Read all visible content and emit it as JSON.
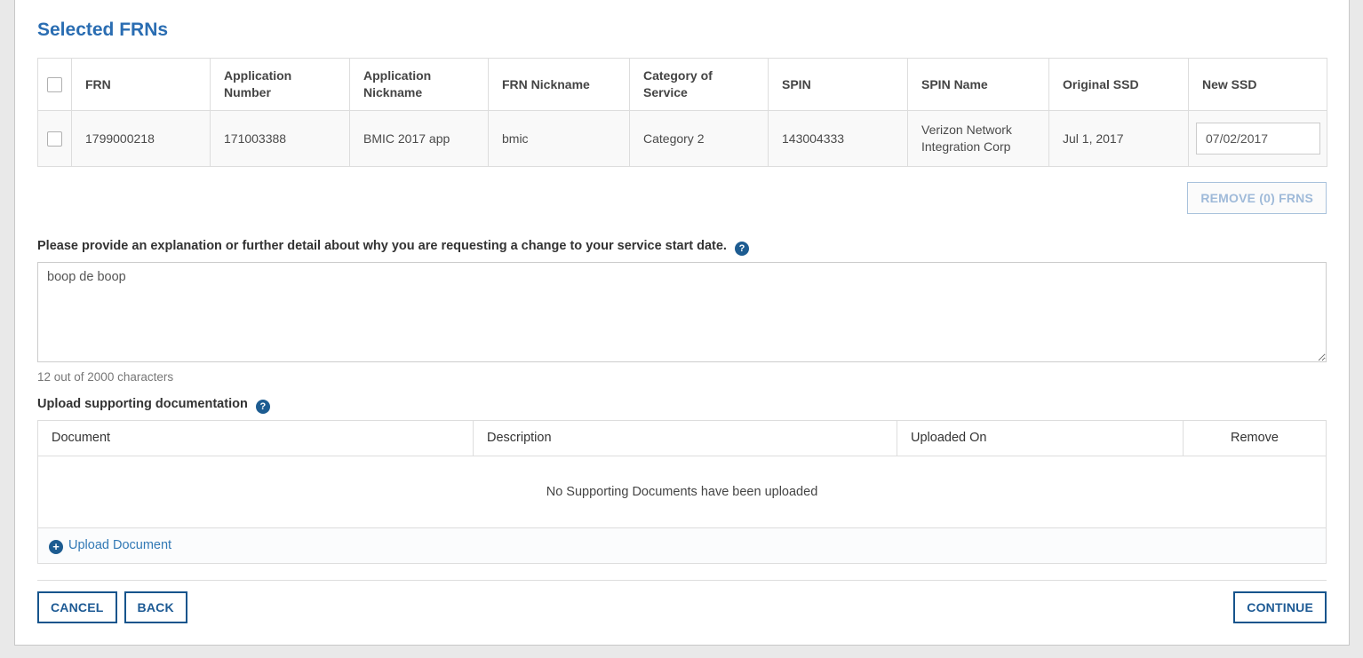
{
  "page": {
    "title": "Selected FRNs"
  },
  "frn_table": {
    "headers": [
      "FRN",
      "Application Number",
      "Application Nickname",
      "FRN Nickname",
      "Category of Service",
      "SPIN",
      "SPIN Name",
      "Original SSD",
      "New SSD"
    ],
    "rows": [
      {
        "frn": "1799000218",
        "application_number": "171003388",
        "application_nickname": "BMIC 2017 app",
        "frn_nickname": "bmic",
        "category_of_service": "Category 2",
        "spin": "143004333",
        "spin_name": "Verizon Network Integration Corp",
        "original_ssd": "Jul 1, 2017",
        "new_ssd_value": "07/02/2017"
      }
    ]
  },
  "remove_button": {
    "label": "REMOVE (0) FRNS"
  },
  "explanation": {
    "label": "Please provide an explanation or further detail about why you are requesting a change to your service start date.",
    "value": "boop de boop",
    "char_counter": "12 out of 2000 characters"
  },
  "documents": {
    "label": "Upload supporting documentation",
    "headers": [
      "Document",
      "Description",
      "Uploaded On",
      "Remove"
    ],
    "empty_message": "No Supporting Documents have been uploaded",
    "upload_link": "Upload Document"
  },
  "footer": {
    "cancel": "CANCEL",
    "back": "BACK",
    "continue": "CONTINUE"
  },
  "icons": {
    "help": "?",
    "plus": "+"
  },
  "colors": {
    "heading": "#2a6db2",
    "link": "#3279b5",
    "button_blue": "#1d5a94",
    "help_icon_bg": "#1d5c91",
    "disabled_button_text": "#9fbad9",
    "row_background": "#f9f9f9",
    "page_background": "#e9e9e9"
  }
}
